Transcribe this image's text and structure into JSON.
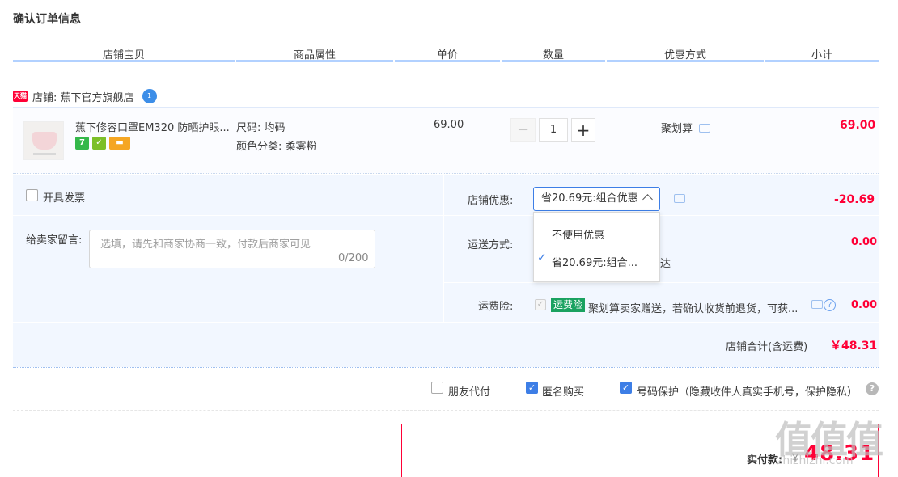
{
  "page_title": "确认订单信息",
  "columns": [
    {
      "label": "店铺宝贝"
    },
    {
      "label": "商品属性"
    },
    {
      "label": "单价"
    },
    {
      "label": "数量"
    },
    {
      "label": "优惠方式"
    },
    {
      "label": "小计"
    }
  ],
  "shop": {
    "badge": "天猫",
    "label": "店铺: 蕉下官方旗舰店",
    "chat_badge": "1"
  },
  "item": {
    "name": "蕉下修容口罩EM320 防晒护眼...",
    "attr_size": "尺码: 均码",
    "attr_color": "颜色分类: 柔雾粉",
    "price": "69.00",
    "qty": "1",
    "minus": "−",
    "plus": "+",
    "promo": "聚划算",
    "subtotal": "69.00",
    "badges": [
      {
        "text": "7",
        "color": "#34b84a"
      },
      {
        "text": "✓",
        "color": "#7cbf28"
      },
      {
        "text": "▬",
        "color": "#f5a623"
      }
    ]
  },
  "options": {
    "invoice_label": "开具发票",
    "message_label": "给卖家留言:",
    "message_placeholder": "选填，请先和商家协商一致，付款后商家可见",
    "message_count": "0/200",
    "shop_discount_label": "店铺优惠:",
    "shop_discount_selected": "省20.69元:组合优惠",
    "shop_discount_amount": "-20.69",
    "dropdown_items": [
      "不使用优惠",
      "省20.69元:组合..."
    ],
    "dropdown_check": "✓",
    "shipping_label": "运送方式:",
    "shipping_hidden_char": "达",
    "shipping_amount": "0.00",
    "insurance_label": "运费险:",
    "insurance_badge": "运费险",
    "insurance_desc": "聚划算卖家赠送，若确认收货前退货，可获...",
    "insurance_amount": "0.00",
    "help_glyph": "?",
    "shop_total_label": "店铺合计(含运费)",
    "shop_total": "￥48.31"
  },
  "checkout_options": {
    "friend_pay": "朋友代付",
    "anonymous": "匿名购买",
    "number_protect": "号码保护（隐藏收件人真实手机号，保护隐私）",
    "check_glyph": "✓",
    "help_glyph": "?"
  },
  "payment": {
    "label": "实付款:",
    "yen": "￥",
    "amount": "48.31"
  },
  "watermark": {
    "glyph": "值值值",
    "url": "zhizhizhi.com"
  },
  "colors": {
    "accent_red": "#ff0036",
    "accent_blue": "#3d7ee6",
    "panel_bg": "#f2f7ff",
    "insurance_green": "#1aa260"
  }
}
